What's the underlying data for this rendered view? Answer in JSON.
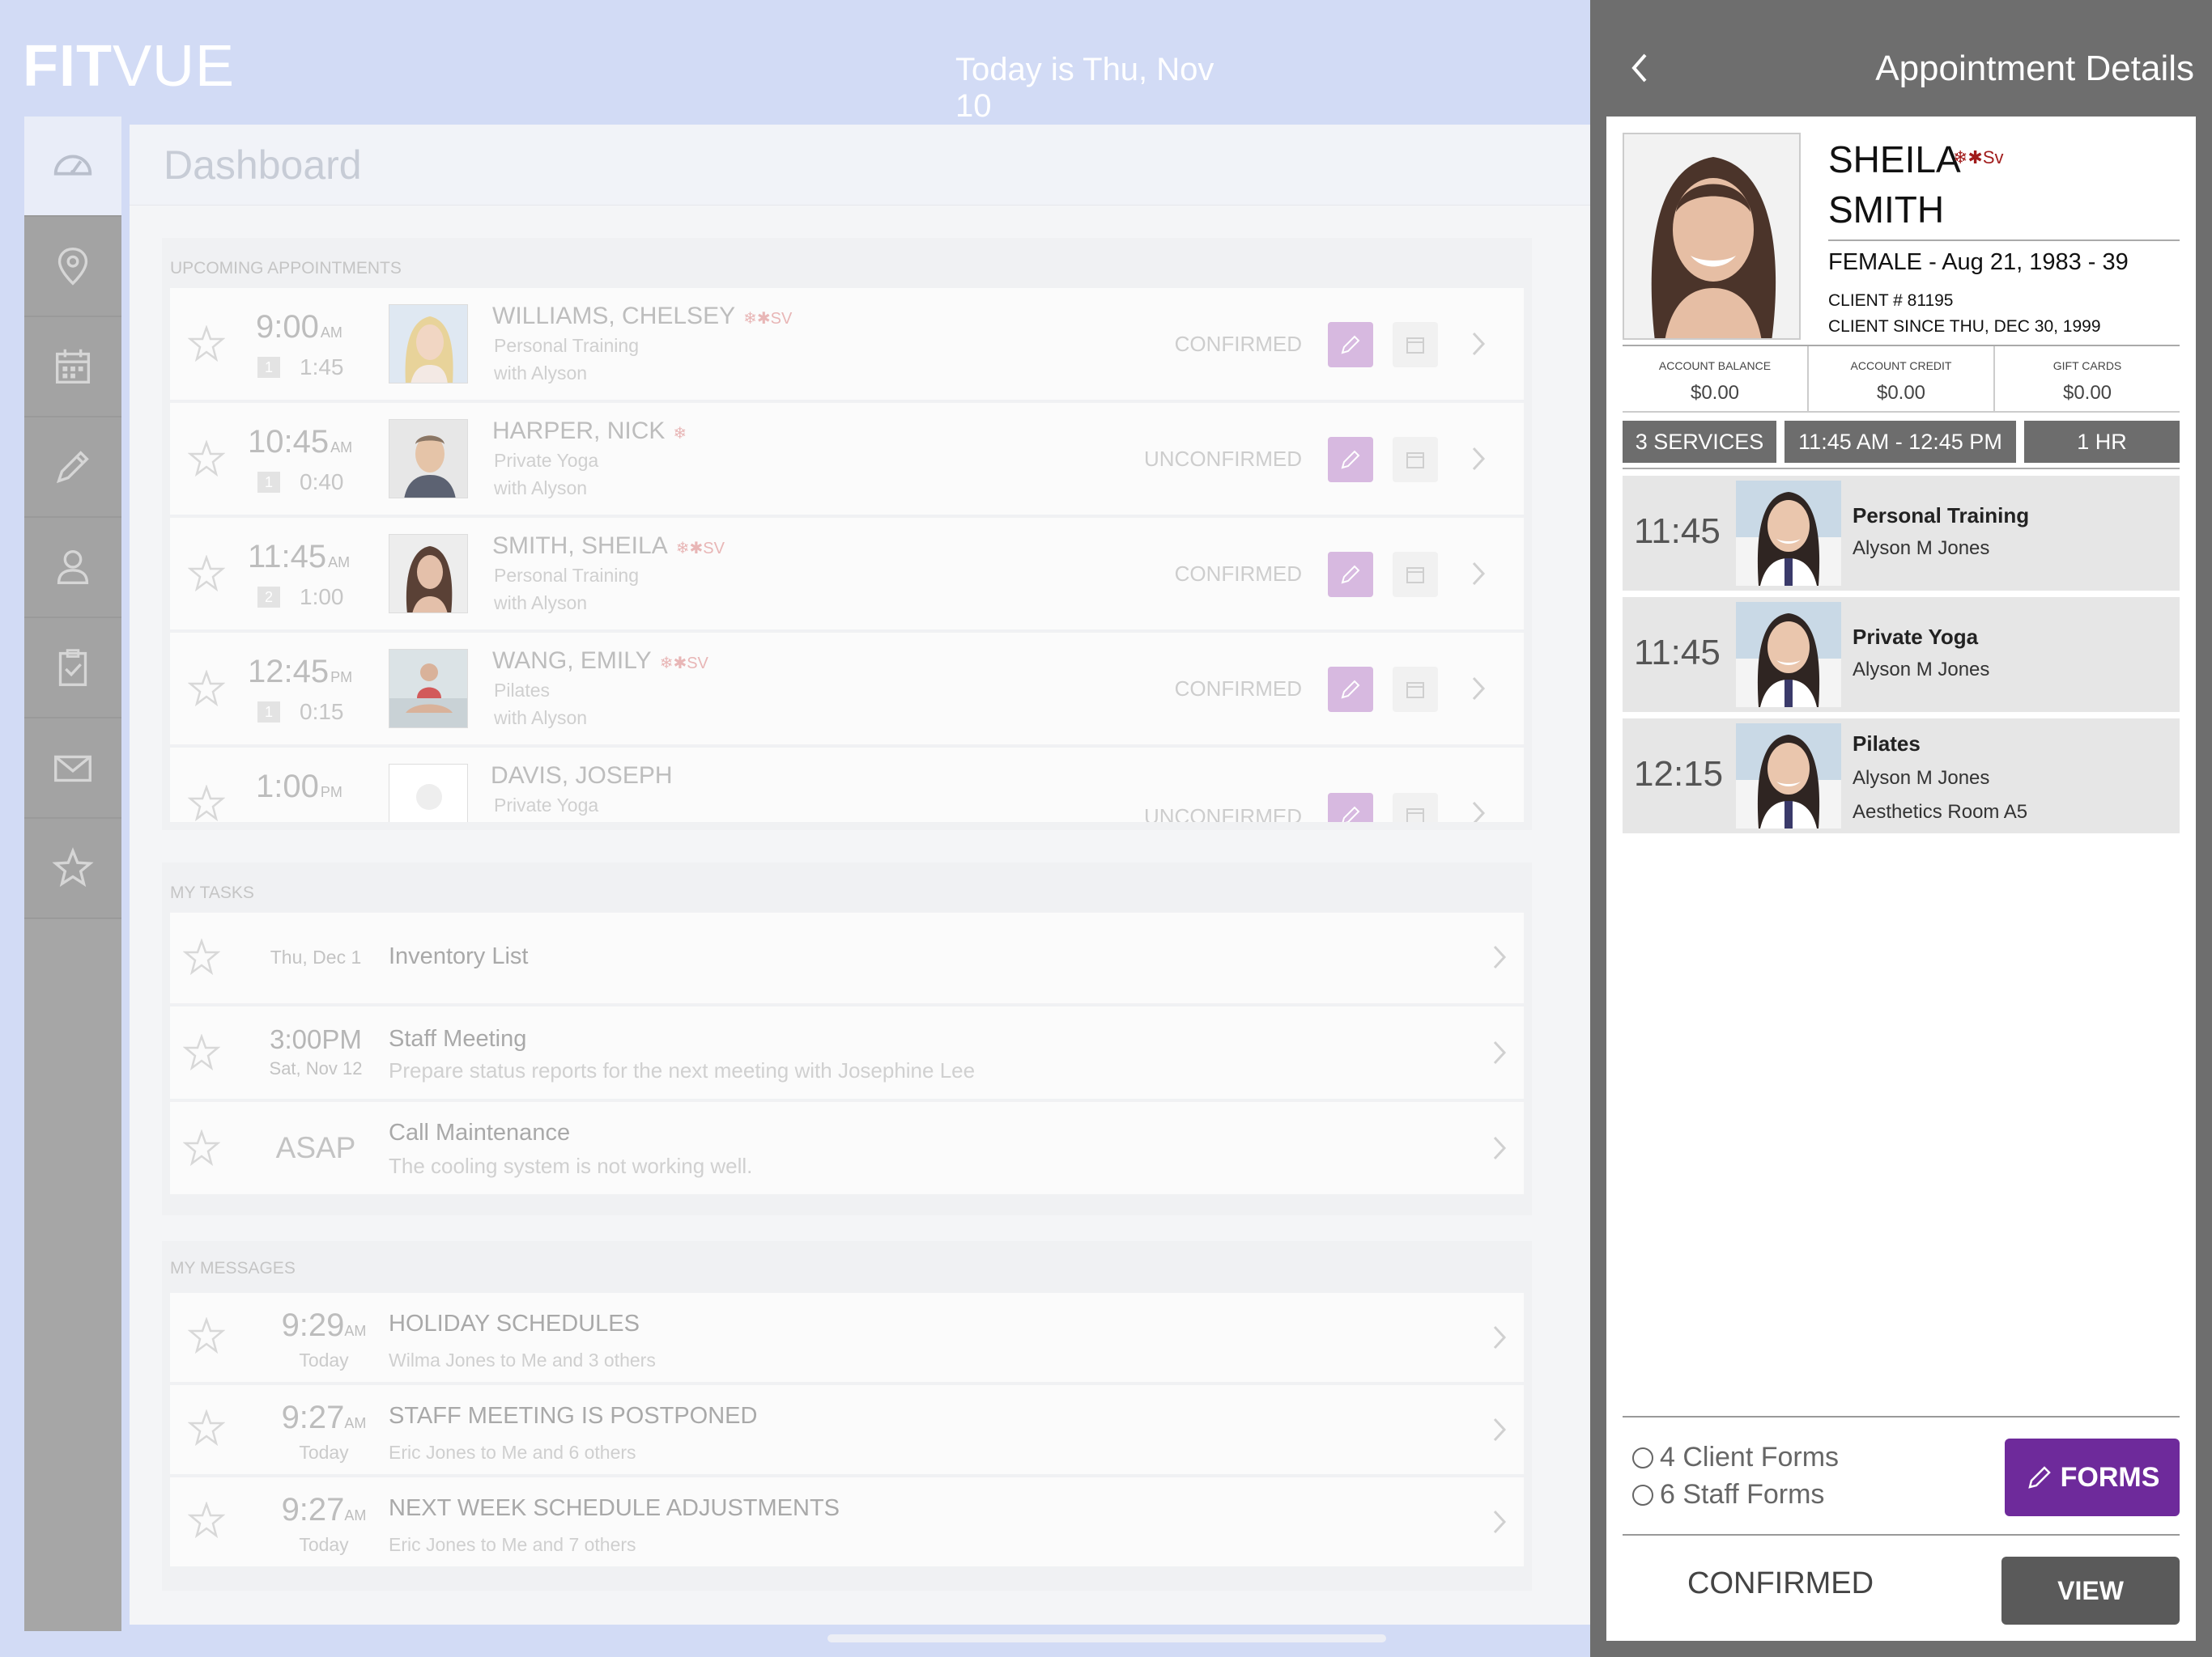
{
  "header": {
    "logo_bold": "FIT",
    "logo_light": "VUE",
    "today": "Today is Thu, Nov 10"
  },
  "nav": {
    "items": [
      "dashboard",
      "locations",
      "calendar",
      "notes",
      "clients",
      "tasks",
      "messages",
      "favorites"
    ]
  },
  "dashboard": {
    "title": "Dashboard",
    "appointments_label": "UPCOMING APPOINTMENTS",
    "appointments": [
      {
        "time": "9:00",
        "ampm": "AM",
        "count": "1",
        "duration": "1:45",
        "name": "WILLIAMS, CHELSEY",
        "tags": "❄✱Sv",
        "service": "Personal Training",
        "with": "with Alyson",
        "status": "CONFIRMED"
      },
      {
        "time": "10:45",
        "ampm": "AM",
        "count": "1",
        "duration": "0:40",
        "name": "HARPER, NICK",
        "tags": "❄",
        "service": "Private Yoga",
        "with": "with Alyson",
        "status": "UNCONFIRMED"
      },
      {
        "time": "11:45",
        "ampm": "AM",
        "count": "2",
        "duration": "1:00",
        "name": "SMITH, SHEILA",
        "tags": "❄✱Sv",
        "service": "Personal Training",
        "with": "with Alyson",
        "status": "CONFIRMED"
      },
      {
        "time": "12:45",
        "ampm": "PM",
        "count": "1",
        "duration": "0:15",
        "name": "WANG, EMILY",
        "tags": "❄✱Sv",
        "service": "Pilates",
        "with": "with Alyson",
        "status": "CONFIRMED"
      },
      {
        "time": "1:00",
        "ampm": "PM",
        "count": "",
        "duration": "",
        "name": "DAVIS, JOSEPH",
        "tags": "",
        "service": "Private Yoga",
        "with": "",
        "status": "UNCONFIRMED"
      }
    ],
    "tasks_label": "MY TASKS",
    "tasks": [
      {
        "when": "Thu, Dec 1",
        "when_sub": "",
        "title": "Inventory List",
        "desc": ""
      },
      {
        "when": "3:00PM",
        "when_sub": "Sat, Nov 12",
        "title": "Staff Meeting",
        "desc": "Prepare status reports for the next meeting with Josephine Lee"
      },
      {
        "when": "ASAP",
        "when_sub": "",
        "title": "Call Maintenance",
        "desc": "The cooling system is not working well."
      }
    ],
    "messages_label": "MY MESSAGES",
    "messages": [
      {
        "time": "9:29",
        "ampm": "AM",
        "day": "Today",
        "subject": "HOLIDAY SCHEDULES",
        "from": "Wilma Jones to Me and 3 others"
      },
      {
        "time": "9:27",
        "ampm": "AM",
        "day": "Today",
        "subject": "STAFF MEETING IS POSTPONED",
        "from": "Eric Jones to Me and 6 others"
      },
      {
        "time": "9:27",
        "ampm": "AM",
        "day": "Today",
        "subject": "NEXT WEEK SCHEDULE ADJUSTMENTS",
        "from": "Eric Jones to Me and 7 others"
      }
    ]
  },
  "panel": {
    "title": "Appointment Details",
    "client": {
      "first": "SHEILA",
      "last": "SMITH",
      "tags": "❄✱Sv",
      "demographics": "FEMALE - Aug 21, 1983 - 39",
      "client_number": "CLIENT # 81195",
      "client_since": "CLIENT SINCE THU, DEC 30, 1999"
    },
    "balances": [
      {
        "label": "ACCOUNT BALANCE",
        "value": "$0.00"
      },
      {
        "label": "ACCOUNT CREDIT",
        "value": "$0.00"
      },
      {
        "label": "GIFT CARDS",
        "value": "$0.00"
      }
    ],
    "summary": {
      "services": "3 SERVICES",
      "range": "11:45 AM - 12:45 PM",
      "length": "1 HR"
    },
    "services": [
      {
        "time": "11:45",
        "name": "Personal Training",
        "staff": "Alyson M Jones",
        "room": ""
      },
      {
        "time": "11:45",
        "name": "Private Yoga",
        "staff": "Alyson M Jones",
        "room": ""
      },
      {
        "time": "12:15",
        "name": "Pilates",
        "staff": "Alyson M Jones",
        "room": "Aesthetics Room A5"
      }
    ],
    "forms": {
      "client_forms": "4 Client Forms",
      "staff_forms": "6 Staff Forms",
      "button": "FORMS"
    },
    "footer": {
      "status": "CONFIRMED",
      "view_button": "VIEW"
    }
  },
  "colors": {
    "accent": "#6e2a9b",
    "edit_button": "#d7b9e0",
    "panel_bg": "#6e6e6e",
    "page_bg": "#d2dbf5"
  }
}
